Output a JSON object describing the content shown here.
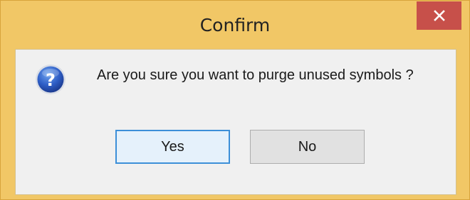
{
  "dialog": {
    "title": "Confirm",
    "message": "Are you sure you want to purge unused symbols ?",
    "icon": "question-icon",
    "buttons": {
      "yes_label": "Yes",
      "no_label": "No"
    },
    "close_icon": "close-icon"
  },
  "colors": {
    "titlebar": "#f1c766",
    "close_button": "#c7504a",
    "client_background": "#f0f0f0",
    "default_button_border": "#3c8fd8"
  }
}
